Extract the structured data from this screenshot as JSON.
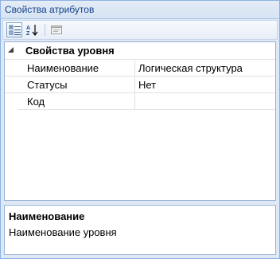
{
  "panel": {
    "title": "Свойства атрибутов"
  },
  "toolbar": {
    "buttons": [
      {
        "name": "categorized-view",
        "icon": "categorized-icon",
        "active": true
      },
      {
        "name": "alphabetical-sort",
        "icon": "sort-az-icon",
        "active": false
      },
      {
        "name": "property-pages",
        "icon": "property-pages-icon",
        "active": false,
        "disabled": true
      }
    ]
  },
  "grid": {
    "category": {
      "label": "Свойства уровня",
      "expanded": true
    },
    "properties": [
      {
        "name": "Наименование",
        "value": "Логическая структура"
      },
      {
        "name": "Статусы",
        "value": "Нет"
      },
      {
        "name": "Код",
        "value": ""
      }
    ]
  },
  "help": {
    "title": "Наименование",
    "description": "Наименование уровня"
  },
  "colors": {
    "panel_bg": "#dfe9f5",
    "title_text": "#15428b",
    "border": "#9ab3d4"
  }
}
